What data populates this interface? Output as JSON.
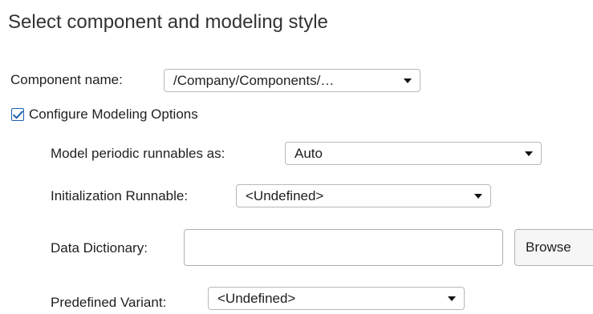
{
  "title": "Select component and modeling style",
  "component": {
    "label": "Component name:",
    "value": "/Company/Components/…"
  },
  "configure": {
    "label": "Configure Modeling Options",
    "checked": true
  },
  "periodic": {
    "label": "Model periodic runnables as:",
    "value": "Auto"
  },
  "init": {
    "label": "Initialization Runnable:",
    "value": "<Undefined>"
  },
  "dictionary": {
    "label": "Data Dictionary:",
    "value": "",
    "browse_label": "Browse"
  },
  "variant": {
    "label": "Predefined Variant:",
    "value": "<Undefined>"
  }
}
